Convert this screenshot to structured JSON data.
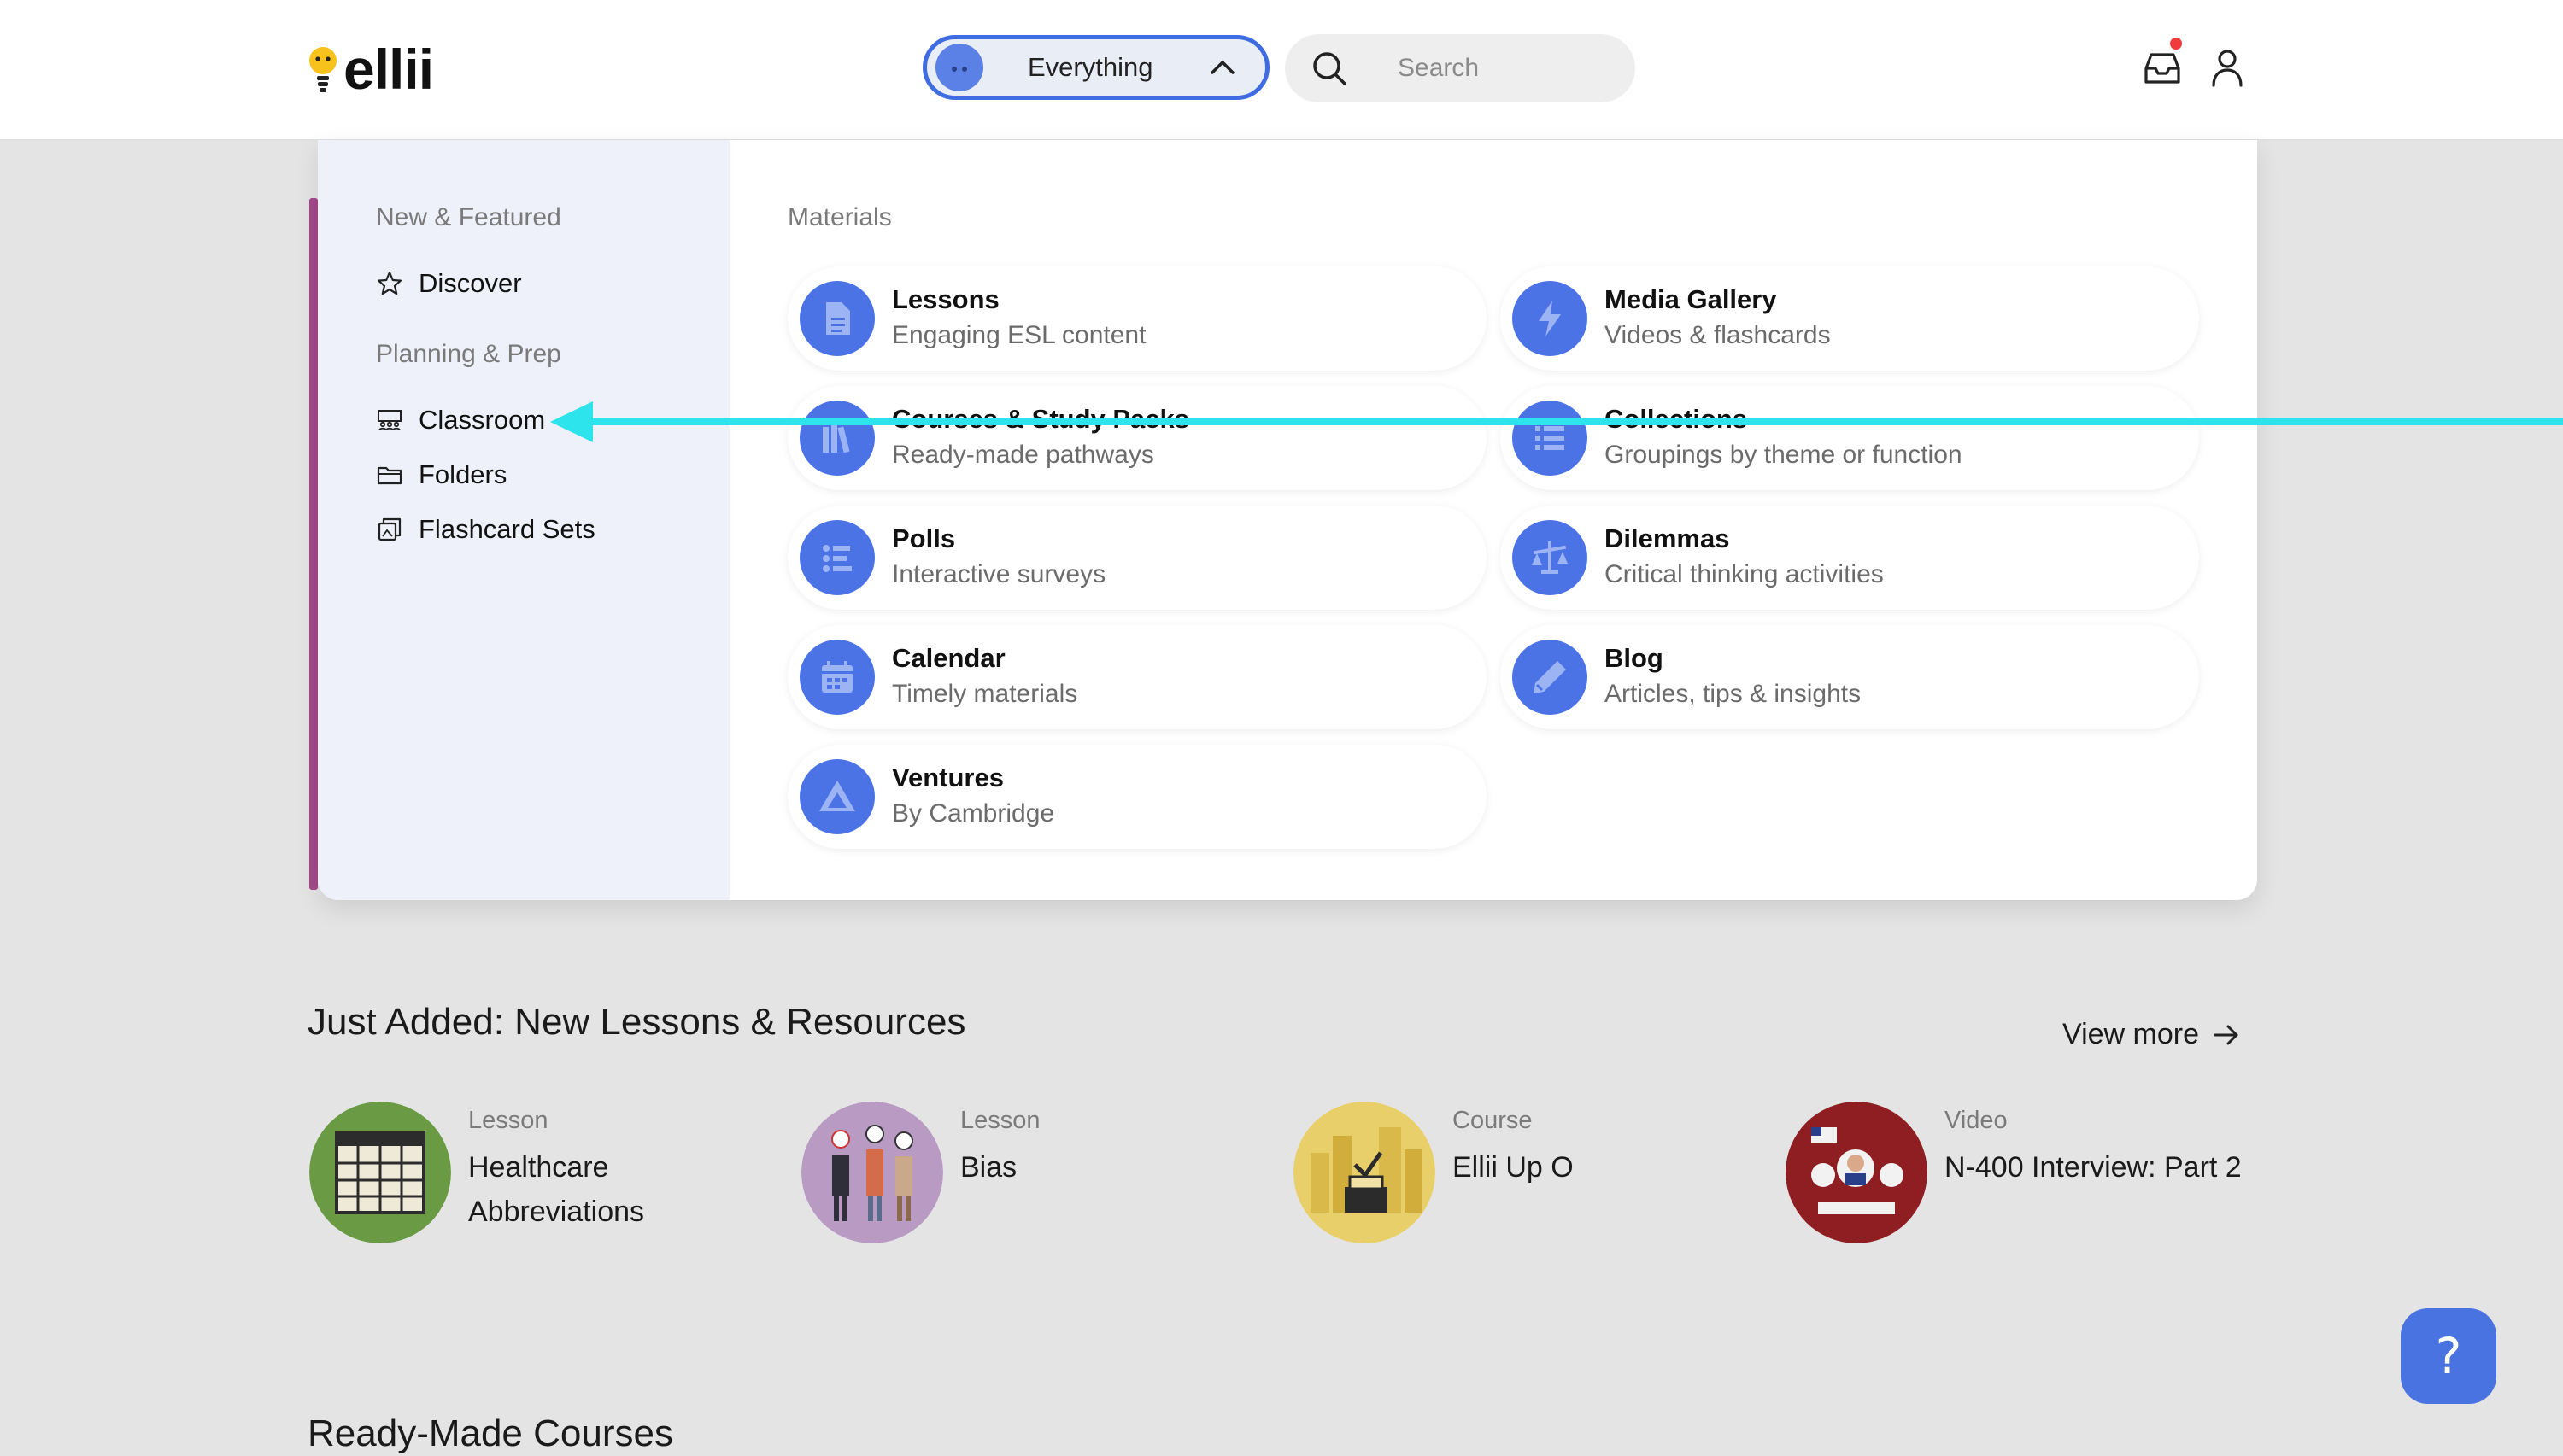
{
  "header": {
    "logo_text": "ellii",
    "scope_label": "Everything",
    "search_placeholder": "Search",
    "has_notification": true
  },
  "menu": {
    "side": {
      "new_featured_heading": "New & Featured",
      "discover": "Discover",
      "planning_heading": "Planning & Prep",
      "classroom": "Classroom",
      "folders": "Folders",
      "flashcard_sets": "Flashcard Sets"
    },
    "materials_heading": "Materials",
    "materials": [
      {
        "title": "Lessons",
        "subtitle": "Engaging ESL content",
        "icon": "document-icon"
      },
      {
        "title": "Media Gallery",
        "subtitle": "Videos & flashcards",
        "icon": "lightning-icon"
      },
      {
        "title": "Courses & Study Packs",
        "subtitle": "Ready-made pathways",
        "icon": "books-icon"
      },
      {
        "title": "Collections",
        "subtitle": "Groupings by theme or function",
        "icon": "list-icon"
      },
      {
        "title": "Polls",
        "subtitle": "Interactive surveys",
        "icon": "poll-icon"
      },
      {
        "title": "Dilemmas",
        "subtitle": "Critical thinking activities",
        "icon": "scales-icon"
      },
      {
        "title": "Calendar",
        "subtitle": "Timely materials",
        "icon": "calendar-icon"
      },
      {
        "title": "Blog",
        "subtitle": "Articles, tips & insights",
        "icon": "pencil-icon"
      },
      {
        "title": "Ventures",
        "subtitle": "By Cambridge",
        "icon": "ventures-icon"
      }
    ]
  },
  "just_added": {
    "title": "Just Added: New Lessons & Resources",
    "view_more": "View more",
    "items": [
      {
        "type": "Lesson",
        "title": "Healthcare Abbreviations",
        "thumb_color": "#6a9a43"
      },
      {
        "type": "Lesson",
        "title": "Bias",
        "thumb_color": "#b89ac3"
      },
      {
        "type": "Course",
        "title": "Ellii Up O",
        "thumb_color": "#e8cf6a"
      },
      {
        "type": "Video",
        "title": "N-400 Interview: Part 2",
        "thumb_color": "#8e1e22"
      }
    ]
  },
  "ready_made": {
    "title": "Ready-Made Courses"
  },
  "help": {
    "label": "?"
  },
  "colors": {
    "accent_blue": "#4b73e6",
    "scope_border": "#3f6ce0",
    "sidebar_accent": "#a4498c",
    "annotation_arrow": "#2de4ec",
    "notification_dot": "#ef3b3b"
  }
}
